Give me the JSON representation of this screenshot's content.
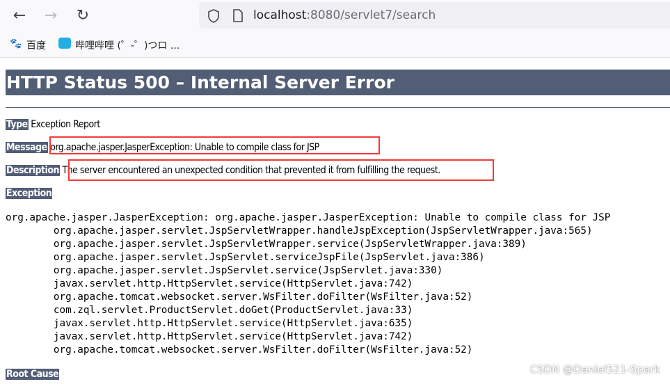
{
  "browser": {
    "url_host": "localhost",
    "url_rest": ":8080/servlet7/search",
    "bookmarks": [
      "百度",
      "哔哩哔哩 (゜-゜)つロ ..."
    ]
  },
  "page": {
    "title": "HTTP Status 500 – Internal Server Error",
    "type_label": "Type",
    "type_value": "Exception Report",
    "message_label": "Message",
    "message_value": "org.apache.jasper.JasperException: Unable to compile class for JSP",
    "description_label": "Description",
    "description_value": "The server encountered an unexpected condition that prevented it from fulfilling the request.",
    "exception_label": "Exception",
    "stack_trace": "org.apache.jasper.JasperException: org.apache.jasper.JasperException: Unable to compile class for JSP\n\torg.apache.jasper.servlet.JspServletWrapper.handleJspException(JspServletWrapper.java:565)\n\torg.apache.jasper.servlet.JspServletWrapper.service(JspServletWrapper.java:389)\n\torg.apache.jasper.servlet.JspServlet.serviceJspFile(JspServlet.java:386)\n\torg.apache.jasper.servlet.JspServlet.service(JspServlet.java:330)\n\tjavax.servlet.http.HttpServlet.service(HttpServlet.java:742)\n\torg.apache.tomcat.websocket.server.WsFilter.doFilter(WsFilter.java:52)\n\tcom.zql.servlet.ProductServlet.doGet(ProductServlet.java:33)\n\tjavax.servlet.http.HttpServlet.service(HttpServlet.java:635)\n\tjavax.servlet.http.HttpServlet.service(HttpServlet.java:742)\n\torg.apache.tomcat.websocket.server.WsFilter.doFilter(WsFilter.java:52)",
    "root_cause_label": "Root Cause"
  },
  "watermark": "CSDN @Daniel521-Spark",
  "colors": {
    "header": "#525D76",
    "highlight_box": "#f03a3a"
  }
}
